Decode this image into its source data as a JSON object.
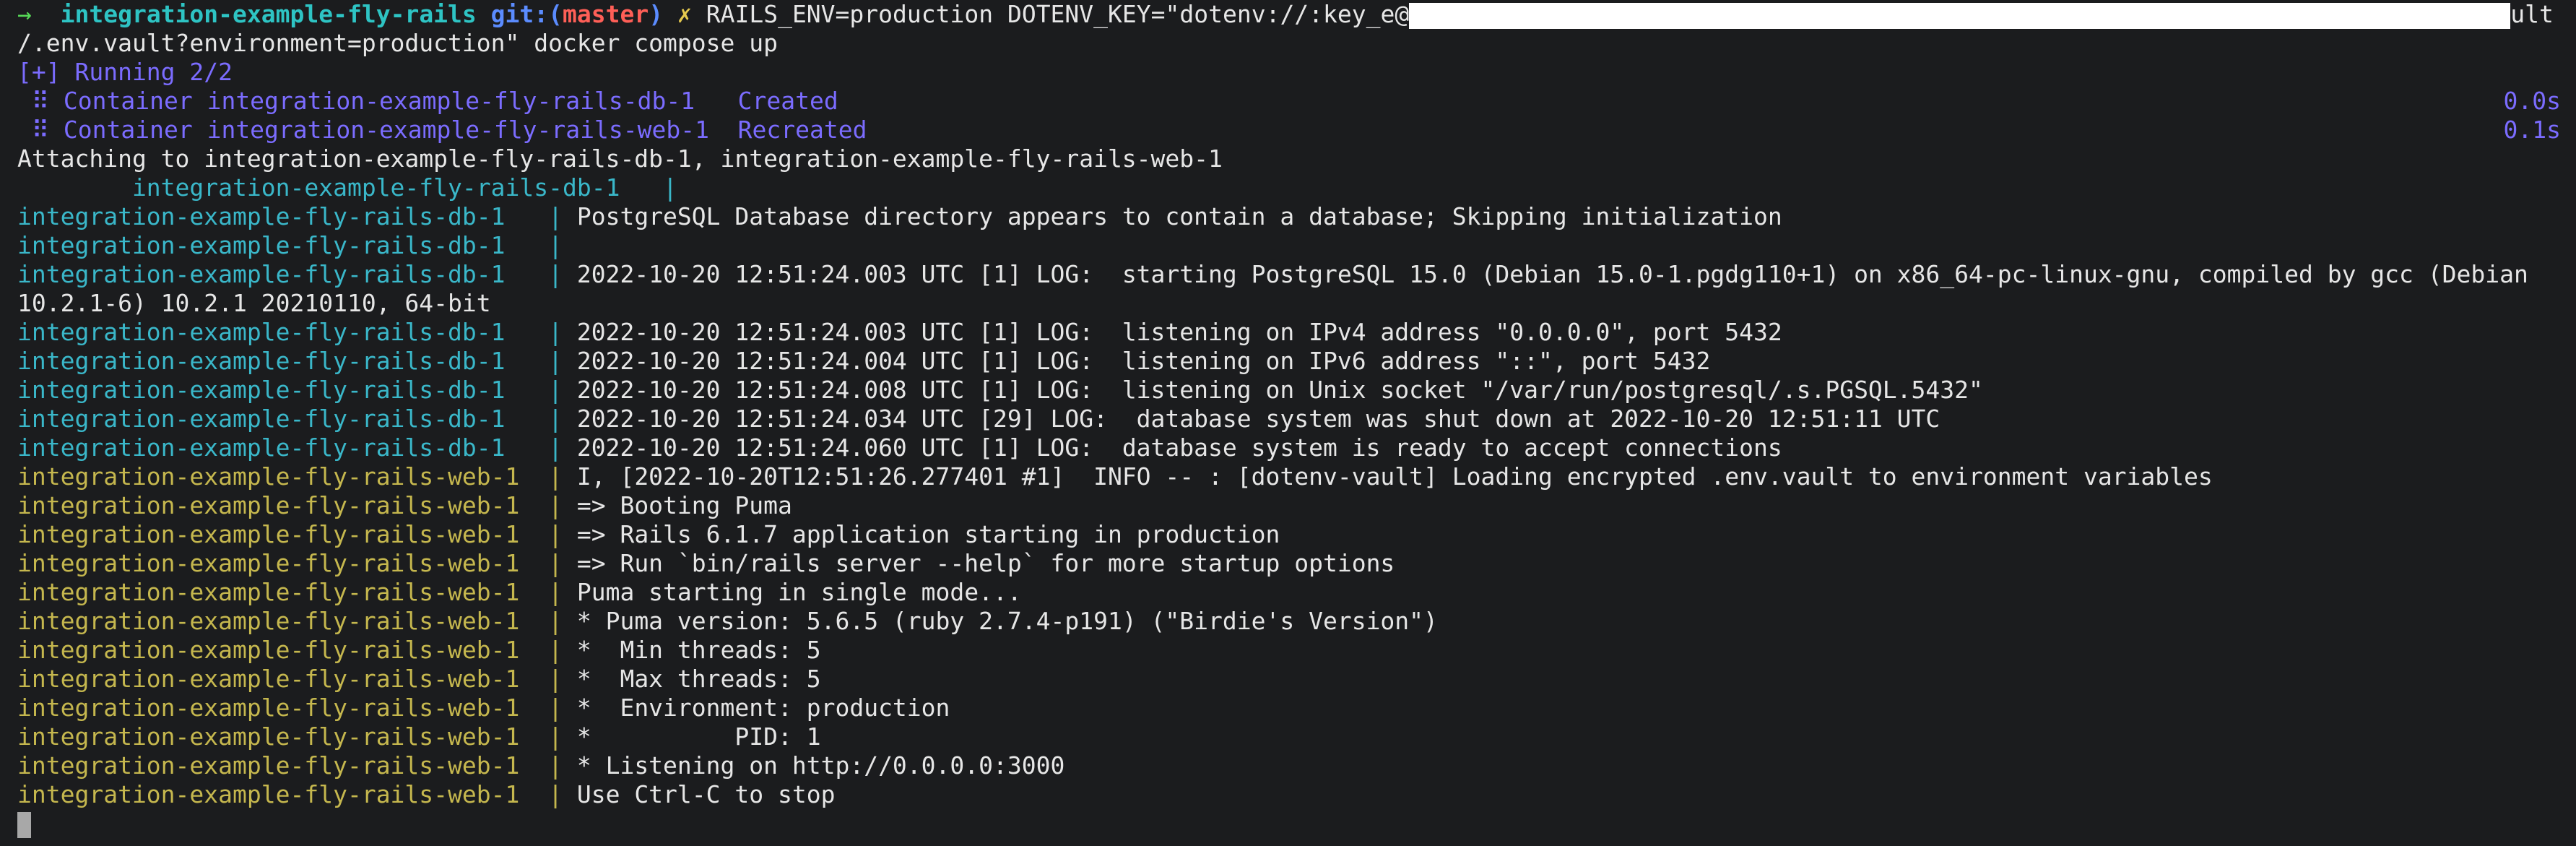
{
  "prompt": {
    "arrow": "→",
    "dir": "integration-example-fly-rails",
    "git_label": "git:(",
    "branch": "master",
    "git_close": ")",
    "dirty_mark": "✗",
    "command_start": "RAILS_ENV=production DOTENV_KEY=\"dotenv://:key_e@",
    "command_end_line1": "ult",
    "command_line2": "/.env.vault?environment=production\" docker compose up"
  },
  "compose": {
    "running": "[+] Running 2/2",
    "containers": [
      {
        "text": " ⠿ Container integration-example-fly-rails-db-1   Created",
        "time": "0.0s"
      },
      {
        "text": " ⠿ Container integration-example-fly-rails-web-1  Recreated",
        "time": "0.1s"
      }
    ],
    "attaching": "Attaching to integration-example-fly-rails-db-1, integration-example-fly-rails-web-1"
  },
  "logs": [
    {
      "svc": "db",
      "prefix": "        integration-example-fly-rails-db-1   |",
      "msg": ""
    },
    {
      "svc": "db",
      "prefix": "integration-example-fly-rails-db-1   | ",
      "msg": "PostgreSQL Database directory appears to contain a database; Skipping initialization"
    },
    {
      "svc": "db",
      "prefix": "integration-example-fly-rails-db-1   | ",
      "msg": ""
    },
    {
      "svc": "db",
      "prefix": "integration-example-fly-rails-db-1   | ",
      "msg": "2022-10-20 12:51:24.003 UTC [1] LOG:  starting PostgreSQL 15.0 (Debian 15.0-1.pgdg110+1) on x86_64-pc-linux-gnu, compiled by gcc (Debian"
    },
    {
      "svc": "plain",
      "prefix": "",
      "msg": "10.2.1-6) 10.2.1 20210110, 64-bit"
    },
    {
      "svc": "db",
      "prefix": "integration-example-fly-rails-db-1   | ",
      "msg": "2022-10-20 12:51:24.003 UTC [1] LOG:  listening on IPv4 address \"0.0.0.0\", port 5432"
    },
    {
      "svc": "db",
      "prefix": "integration-example-fly-rails-db-1   | ",
      "msg": "2022-10-20 12:51:24.004 UTC [1] LOG:  listening on IPv6 address \"::\", port 5432"
    },
    {
      "svc": "db",
      "prefix": "integration-example-fly-rails-db-1   | ",
      "msg": "2022-10-20 12:51:24.008 UTC [1] LOG:  listening on Unix socket \"/var/run/postgresql/.s.PGSQL.5432\""
    },
    {
      "svc": "db",
      "prefix": "integration-example-fly-rails-db-1   | ",
      "msg": "2022-10-20 12:51:24.034 UTC [29] LOG:  database system was shut down at 2022-10-20 12:51:11 UTC"
    },
    {
      "svc": "db",
      "prefix": "integration-example-fly-rails-db-1   | ",
      "msg": "2022-10-20 12:51:24.060 UTC [1] LOG:  database system is ready to accept connections"
    },
    {
      "svc": "web",
      "prefix": "integration-example-fly-rails-web-1  | ",
      "msg": "I, [2022-10-20T12:51:26.277401 #1]  INFO -- : [dotenv-vault] Loading encrypted .env.vault to environment variables"
    },
    {
      "svc": "web",
      "prefix": "integration-example-fly-rails-web-1  | ",
      "msg": "=> Booting Puma"
    },
    {
      "svc": "web",
      "prefix": "integration-example-fly-rails-web-1  | ",
      "msg": "=> Rails 6.1.7 application starting in production"
    },
    {
      "svc": "web",
      "prefix": "integration-example-fly-rails-web-1  | ",
      "msg": "=> Run `bin/rails server --help` for more startup options"
    },
    {
      "svc": "web",
      "prefix": "integration-example-fly-rails-web-1  | ",
      "msg": "Puma starting in single mode..."
    },
    {
      "svc": "web",
      "prefix": "integration-example-fly-rails-web-1  | ",
      "msg": "* Puma version: 5.6.5 (ruby 2.7.4-p191) (\"Birdie's Version\")"
    },
    {
      "svc": "web",
      "prefix": "integration-example-fly-rails-web-1  | ",
      "msg": "*  Min threads: 5"
    },
    {
      "svc": "web",
      "prefix": "integration-example-fly-rails-web-1  | ",
      "msg": "*  Max threads: 5"
    },
    {
      "svc": "web",
      "prefix": "integration-example-fly-rails-web-1  | ",
      "msg": "*  Environment: production"
    },
    {
      "svc": "web",
      "prefix": "integration-example-fly-rails-web-1  | ",
      "msg": "*          PID: 1"
    },
    {
      "svc": "web",
      "prefix": "integration-example-fly-rails-web-1  | ",
      "msg": "* Listening on http://0.0.0.0:3000"
    },
    {
      "svc": "web",
      "prefix": "integration-example-fly-rails-web-1  | ",
      "msg": "Use Ctrl-C to stop"
    }
  ],
  "colors": {
    "background": "#1b1c1e",
    "db_service": "#3ab7c9",
    "web_service": "#c5b74e",
    "compose_status": "#7b6cff"
  }
}
